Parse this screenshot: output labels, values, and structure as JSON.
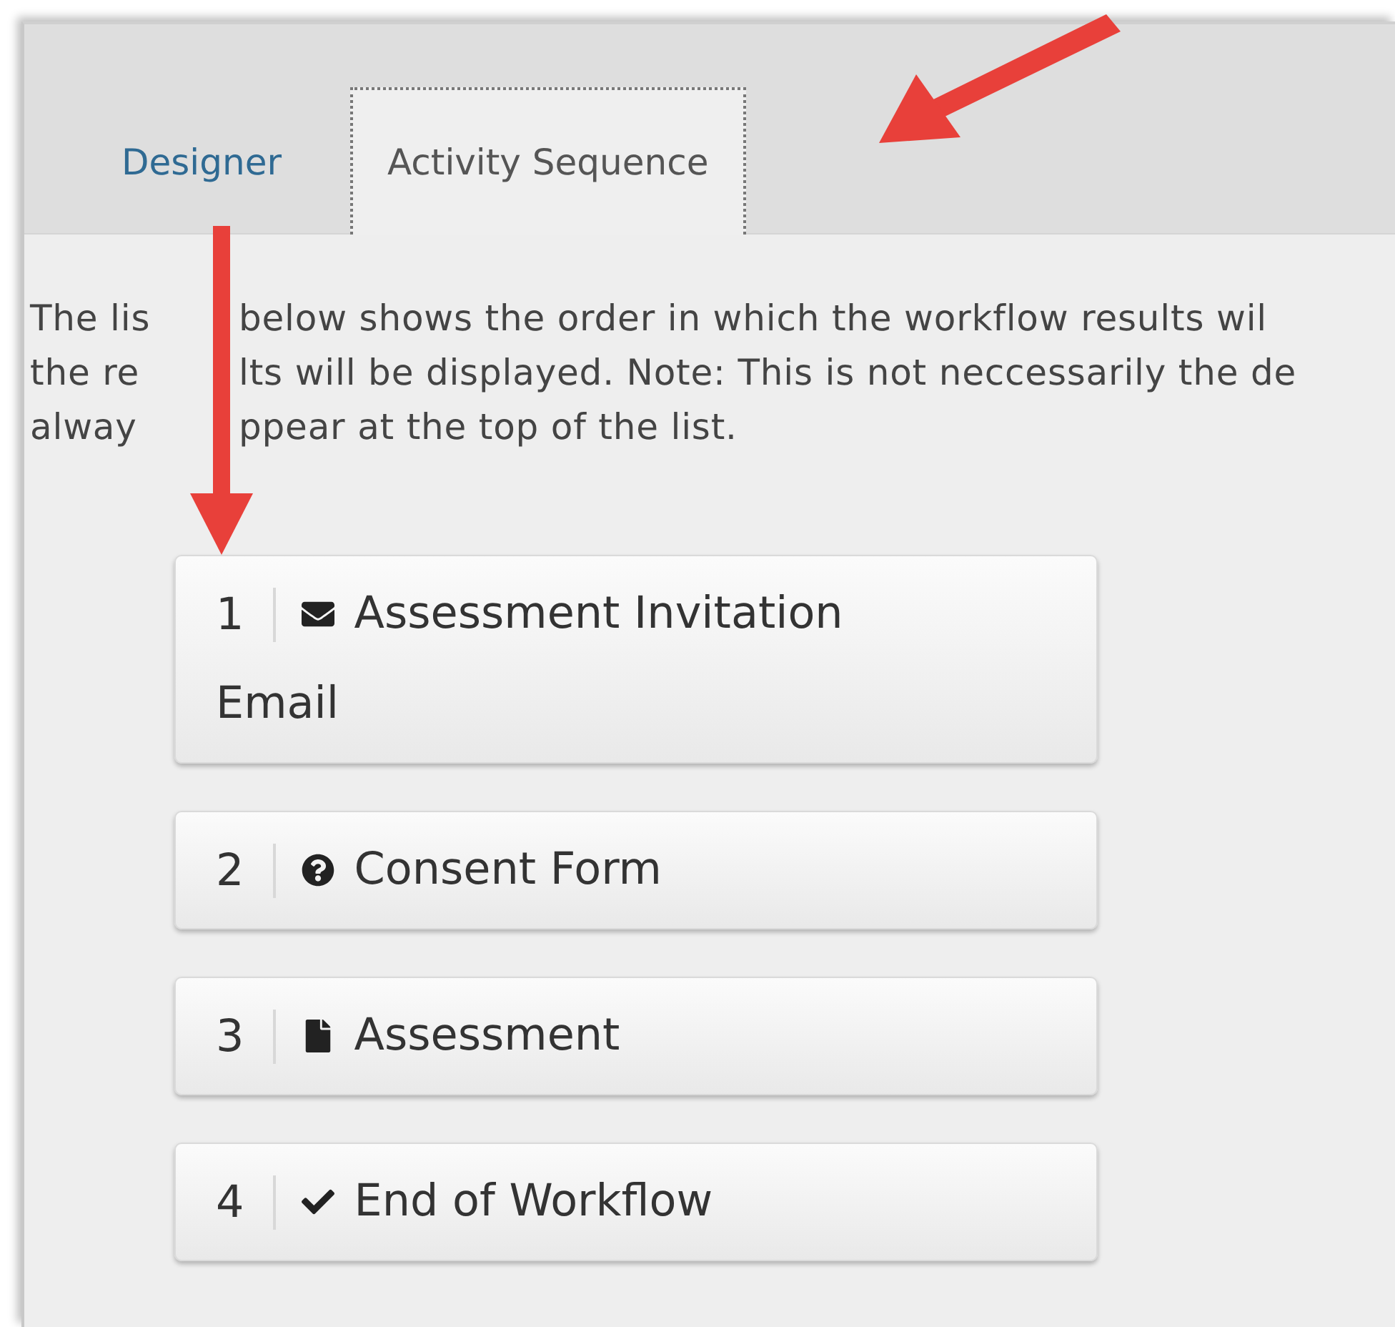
{
  "tabs": [
    {
      "label": "Designer",
      "selected": false
    },
    {
      "label": "Activity Sequence",
      "selected": true
    }
  ],
  "description": [
    [
      "The lis",
      "below shows the order in which the workflow results wil"
    ],
    [
      "the re",
      "lts will be displayed. Note: This is not neccessarily the de"
    ],
    [
      "alway",
      "ppear at the top of the list."
    ]
  ],
  "activities": [
    {
      "number": "1",
      "kind": "email",
      "label": [
        "Assessment Invitation",
        "Email"
      ]
    },
    {
      "number": "2",
      "kind": "question",
      "label": [
        "Consent Form"
      ]
    },
    {
      "number": "3",
      "kind": "document",
      "label": [
        "Assessment"
      ]
    },
    {
      "number": "4",
      "kind": "end",
      "label": [
        "End of Workflow"
      ]
    }
  ],
  "annotations": [
    {
      "kind": "arrow"
    },
    {
      "kind": "arrow"
    }
  ]
}
